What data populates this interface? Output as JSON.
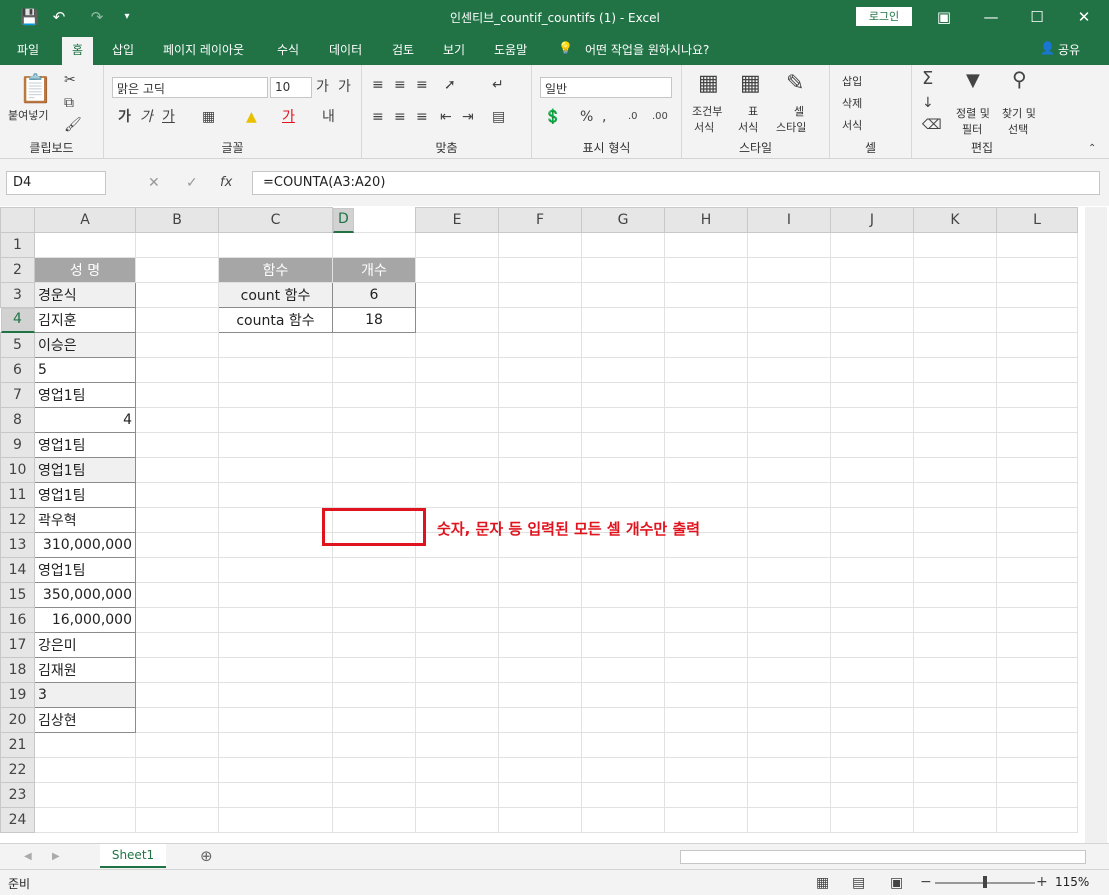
{
  "window": {
    "title": "인센티브_countif_countifs (1)  -  Excel",
    "login_label": "로그인"
  },
  "tabs": [
    "파일",
    "홈",
    "삽입",
    "페이지 레이아웃",
    "수식",
    "데이터",
    "검토",
    "보기",
    "도움말"
  ],
  "tell_me": "어떤 작업을 원하시나요?",
  "share": "공유",
  "ribbon": {
    "clipboard": {
      "paste": "붙여넣기",
      "label": "클립보드"
    },
    "font": {
      "name": "맑은 고딕",
      "size": "10",
      "label": "글꼴"
    },
    "align": {
      "label": "맞춤"
    },
    "number": {
      "format": "일반",
      "label": "표시 형식"
    },
    "styles": {
      "cond1": "조건부",
      "cond2": "서식",
      "table1": "표",
      "table2": "서식",
      "cell1": "셀",
      "cell2": "스타일",
      "label": "스타일"
    },
    "cells": {
      "insert": "삽입",
      "delete": "삭제",
      "format": "서식",
      "label": "셀"
    },
    "editing": {
      "sort1": "정렬 및",
      "sort2": "필터",
      "find1": "찾기 및",
      "find2": "선택",
      "label": "편집"
    }
  },
  "formula_bar": {
    "name_box": "D4",
    "formula": "=COUNTA(A3:A20)",
    "fx": "fx"
  },
  "columns": [
    "A",
    "B",
    "C",
    "D",
    "E",
    "F",
    "G",
    "H",
    "I",
    "J",
    "K",
    "L"
  ],
  "rows": [
    {
      "n": "1"
    },
    {
      "n": "2",
      "a": "성  명",
      "c": "함수",
      "d": "개수"
    },
    {
      "n": "3",
      "a": "경운식",
      "c": "count 함수",
      "d": "6"
    },
    {
      "n": "4",
      "a": "김지훈",
      "c": "counta 함수",
      "d": "18"
    },
    {
      "n": "5",
      "a": "이승은"
    },
    {
      "n": "6",
      "a": "5"
    },
    {
      "n": "7",
      "a": "영업1팀"
    },
    {
      "n": "8",
      "a": "4"
    },
    {
      "n": "9",
      "a": "영업1팀"
    },
    {
      "n": "10",
      "a": "영업1팀"
    },
    {
      "n": "11",
      "a": "영업1팀"
    },
    {
      "n": "12",
      "a": "곽우혁"
    },
    {
      "n": "13",
      "a": "310,000,000"
    },
    {
      "n": "14",
      "a": "영업1팀"
    },
    {
      "n": "15",
      "a": "350,000,000"
    },
    {
      "n": "16",
      "a": "16,000,000"
    },
    {
      "n": "17",
      "a": "강은미"
    },
    {
      "n": "18",
      "a": "김재원"
    },
    {
      "n": "19",
      "a": "3"
    },
    {
      "n": "20",
      "a": "김상현"
    },
    {
      "n": "21"
    },
    {
      "n": "22"
    },
    {
      "n": "23"
    },
    {
      "n": "24"
    }
  ],
  "annotation": "숫자, 문자 등 입력된 모든 셀 개수만 출력",
  "sheet_tab": "Sheet1",
  "status": {
    "ready": "준비",
    "zoom": "115%"
  },
  "colors": {
    "accent": "#217346",
    "highlight": "#e0141e"
  }
}
